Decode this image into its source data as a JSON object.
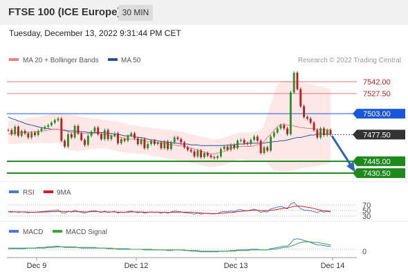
{
  "header": {
    "title": "FTSE 100 (ICE Europe)",
    "timeframe": "30 MIN"
  },
  "timestamp": "Tuesday, December 13, 2022 9:31:44 PM CET",
  "legend": {
    "ma20": "MA 20 + Bollinger Bands",
    "ma50": "MA 50",
    "credit": "Research © 2022 Trading Central",
    "rsi": "RSI",
    "rsi_ma": "9MA",
    "macd": "MACD",
    "macd_signal": "MACD Signal"
  },
  "colors": {
    "ma20": "#f08080",
    "bollinger_fill": "#fde3e3",
    "ma50": "#2c4f9e",
    "pivot_line": "#1a56db",
    "support": "#1e8a1e",
    "resistance": "#e07b7b",
    "up_candle": "#2e8b2e",
    "down_candle": "#b22222",
    "rsi": "#4a78d6",
    "rsi_ma": "#d81b1b",
    "macd": "#4a78d6",
    "macd_signal": "#3ca53c",
    "arrow": "#2f63b3"
  },
  "chart_data": [
    {
      "type": "candlestick",
      "title": "FTSE 100 (ICE Europe)",
      "timeframe": "30 MIN",
      "x_tick_labels": [
        "Dec 9",
        "Dec 12",
        "Dec 13",
        "Dec 14"
      ],
      "ylim": [
        7418,
        7562
      ],
      "last_price": 7477.5,
      "levels": [
        {
          "label": "7542.00",
          "value": 7542.0,
          "kind": "resistance"
        },
        {
          "label": "7527.50",
          "value": 7527.5,
          "kind": "resistance"
        },
        {
          "label": "7503.00",
          "value": 7503.0,
          "kind": "pivot"
        },
        {
          "label": "7477.50",
          "value": 7477.5,
          "kind": "last"
        },
        {
          "label": "7445.00",
          "value": 7445.0,
          "kind": "support"
        },
        {
          "label": "7430.50",
          "value": 7430.5,
          "kind": "support"
        }
      ],
      "close_series": [
        7483,
        7478,
        7487,
        7476,
        7482,
        7479,
        7474,
        7480,
        7477,
        7482,
        7485,
        7487,
        7489,
        7492,
        7495,
        7497,
        7470,
        7463,
        7478,
        7474,
        7488,
        7479,
        7471,
        7465,
        7476,
        7481,
        7486,
        7478,
        7472,
        7483,
        7472,
        7476,
        7479,
        7467,
        7472,
        7470,
        7476,
        7479,
        7473,
        7466,
        7472,
        7461,
        7466,
        7470,
        7466,
        7468,
        7461,
        7469,
        7460,
        7468,
        7474,
        7472,
        7468,
        7462,
        7459,
        7457,
        7451,
        7458,
        7450,
        7455,
        7452,
        7450,
        7449,
        7451,
        7460,
        7463,
        7459,
        7465,
        7461,
        7470,
        7471,
        7467,
        7466,
        7471,
        7475,
        7470,
        7455,
        7462,
        7458,
        7475,
        7480,
        7485,
        7489,
        7485,
        7478,
        7529,
        7553,
        7533,
        7512,
        7499,
        7497,
        7492,
        7483,
        7474,
        7485,
        7477,
        7483,
        7477.5
      ],
      "ma20_series": [
        7478,
        7479,
        7479,
        7480,
        7480,
        7480,
        7480,
        7481,
        7481,
        7481,
        7482,
        7482,
        7483,
        7484,
        7484,
        7484,
        7483,
        7482,
        7481,
        7480,
        7480,
        7479,
        7479,
        7479,
        7479,
        7479,
        7479,
        7479,
        7478,
        7478,
        7477,
        7476,
        7476,
        7475,
        7474,
        7473,
        7472,
        7472,
        7472,
        7471,
        7471,
        7470,
        7469,
        7469,
        7468,
        7468,
        7467,
        7467,
        7466,
        7465,
        7465,
        7464,
        7464,
        7463,
        7462,
        7461,
        7460,
        7459,
        7458,
        7456,
        7455,
        7454,
        7454,
        7455,
        7456,
        7457,
        7459,
        7461,
        7462,
        7463,
        7463,
        7463,
        7463,
        7463,
        7464,
        7465,
        7466,
        7469,
        7474,
        7478,
        7483,
        7487,
        7490,
        7490,
        7489,
        7489,
        7488,
        7487,
        7486,
        7486,
        7485,
        7485,
        7485,
        7484,
        7484,
        7483,
        7483,
        7483
      ],
      "ma50_series": [
        7499,
        7497,
        7496,
        7494,
        7493,
        7491,
        7490,
        7489,
        7488,
        7487,
        7486,
        7485,
        7485,
        7484,
        7484,
        7484,
        7483,
        7483,
        7482,
        7482,
        7482,
        7481,
        7481,
        7481,
        7480,
        7480,
        7480,
        7480,
        7480,
        7480,
        7479,
        7479,
        7478,
        7478,
        7477,
        7476,
        7476,
        7476,
        7475,
        7474,
        7474,
        7473,
        7472,
        7471,
        7471,
        7470,
        7469,
        7469,
        7468,
        7468,
        7467,
        7467,
        7466,
        7466,
        7466,
        7465,
        7465,
        7465,
        7464,
        7464,
        7464,
        7464,
        7464,
        7464,
        7464,
        7464,
        7465,
        7465,
        7465,
        7466,
        7466,
        7466,
        7467,
        7467,
        7467,
        7467,
        7467,
        7467,
        7468,
        7468,
        7469,
        7469,
        7470,
        7470,
        7471,
        7472,
        7473,
        7474,
        7474,
        7475,
        7476,
        7477,
        7477,
        7478,
        7478,
        7478,
        7478,
        7478
      ],
      "bollinger_upper": [
        7494,
        7495,
        7495,
        7496,
        7496,
        7497,
        7498,
        7498,
        7499,
        7499,
        7500,
        7501,
        7502,
        7503,
        7503,
        7504,
        7504,
        7503,
        7503,
        7502,
        7501,
        7500,
        7499,
        7499,
        7498,
        7498,
        7497,
        7497,
        7496,
        7495,
        7495,
        7494,
        7494,
        7493,
        7492,
        7491,
        7490,
        7489,
        7489,
        7488,
        7487,
        7487,
        7486,
        7486,
        7485,
        7485,
        7484,
        7484,
        7483,
        7483,
        7482,
        7482,
        7481,
        7480,
        7479,
        7478,
        7477,
        7476,
        7475,
        7474,
        7473,
        7472,
        7472,
        7472,
        7473,
        7474,
        7475,
        7477,
        7478,
        7479,
        7480,
        7480,
        7480,
        7480,
        7481,
        7482,
        7483,
        7489,
        7502,
        7515,
        7528,
        7537,
        7542,
        7543,
        7543,
        7543,
        7543,
        7543,
        7542,
        7541,
        7540,
        7539,
        7538,
        7537,
        7536,
        7535,
        7534,
        7533
      ],
      "bollinger_lower": [
        7466,
        7466,
        7466,
        7467,
        7467,
        7467,
        7467,
        7467,
        7467,
        7467,
        7467,
        7467,
        7467,
        7467,
        7468,
        7468,
        7464,
        7461,
        7459,
        7458,
        7458,
        7457,
        7458,
        7458,
        7459,
        7460,
        7460,
        7461,
        7461,
        7461,
        7460,
        7459,
        7458,
        7457,
        7456,
        7456,
        7455,
        7455,
        7455,
        7454,
        7454,
        7454,
        7453,
        7452,
        7451,
        7451,
        7450,
        7449,
        7448,
        7447,
        7447,
        7446,
        7446,
        7445,
        7444,
        7443,
        7442,
        7441,
        7440,
        7439,
        7438,
        7438,
        7438,
        7439,
        7440,
        7441,
        7442,
        7444,
        7446,
        7447,
        7447,
        7447,
        7446,
        7446,
        7446,
        7446,
        7446,
        7446,
        7443,
        7438,
        7434,
        7433,
        7432,
        7432,
        7432,
        7433,
        7434,
        7435,
        7436,
        7437,
        7437,
        7438,
        7438,
        7439,
        7440,
        7441,
        7442,
        7443
      ],
      "forecast": {
        "from": 7477.5,
        "to": 7439,
        "direction": "down"
      }
    },
    {
      "type": "line",
      "title": "RSI",
      "series_names": [
        "RSI",
        "9MA"
      ],
      "y_tick_labels": [
        "70",
        "50",
        "30"
      ],
      "ylim": [
        20,
        80
      ],
      "rsi_series": [
        45,
        44,
        46,
        43,
        45,
        44,
        42,
        44,
        43,
        45,
        46,
        47,
        48,
        50,
        51,
        52,
        42,
        40,
        47,
        45,
        51,
        47,
        43,
        41,
        46,
        48,
        50,
        46,
        43,
        48,
        43,
        45,
        47,
        41,
        44,
        43,
        46,
        48,
        45,
        42,
        45,
        40,
        43,
        45,
        43,
        44,
        40,
        45,
        40,
        45,
        48,
        47,
        45,
        42,
        41,
        40,
        37,
        41,
        37,
        40,
        39,
        38,
        38,
        39,
        45,
        47,
        45,
        49,
        46,
        52,
        53,
        50,
        49,
        52,
        55,
        51,
        43,
        47,
        45,
        56,
        59,
        62,
        65,
        61,
        56,
        74,
        79,
        67,
        57,
        52,
        51,
        49,
        46,
        42,
        48,
        44,
        47,
        45
      ],
      "ma_series": [
        46,
        46,
        45,
        45,
        45,
        45,
        44,
        44,
        44,
        44,
        44,
        45,
        45,
        46,
        46,
        47,
        47,
        46,
        46,
        46,
        46,
        46,
        46,
        45,
        45,
        46,
        46,
        46,
        45,
        45,
        45,
        45,
        45,
        44,
        44,
        44,
        44,
        45,
        45,
        45,
        45,
        44,
        44,
        44,
        44,
        44,
        43,
        43,
        43,
        43,
        44,
        44,
        44,
        44,
        44,
        44,
        43,
        42,
        41,
        40,
        40,
        39,
        39,
        39,
        40,
        41,
        42,
        43,
        44,
        46,
        47,
        48,
        49,
        50,
        51,
        51,
        50,
        50,
        50,
        51,
        52,
        54,
        56,
        58,
        59,
        62,
        65,
        66,
        66,
        64,
        62,
        60,
        57,
        54,
        51,
        49,
        48,
        47
      ]
    },
    {
      "type": "line",
      "title": "MACD",
      "series_names": [
        "MACD",
        "MACD Signal"
      ],
      "y_tick_labels": [
        "0"
      ],
      "ylim": [
        -10,
        30
      ],
      "macd_series": [
        2,
        2,
        2,
        2,
        2,
        2,
        2,
        2,
        2,
        3,
        3,
        3,
        4,
        4,
        5,
        5,
        4,
        3,
        3,
        3,
        3,
        3,
        2,
        2,
        2,
        2,
        2,
        2,
        2,
        2,
        1,
        1,
        1,
        0,
        0,
        0,
        0,
        0,
        0,
        0,
        0,
        -1,
        -1,
        -1,
        -1,
        -1,
        -1,
        -1,
        -2,
        -2,
        -1,
        -1,
        -1,
        -2,
        -2,
        -3,
        -3,
        -3,
        -4,
        -4,
        -4,
        -4,
        -4,
        -4,
        -3,
        -3,
        -3,
        -2,
        -2,
        -1,
        -1,
        -1,
        -1,
        0,
        0,
        0,
        -1,
        -1,
        -1,
        1,
        2,
        3,
        4,
        5,
        5,
        10,
        16,
        17,
        16,
        14,
        13,
        11,
        9,
        7,
        7,
        6,
        5,
        5
      ],
      "signal_series": [
        1,
        1,
        1,
        1,
        1,
        1,
        2,
        2,
        2,
        2,
        2,
        2,
        3,
        3,
        3,
        4,
        4,
        4,
        4,
        4,
        4,
        3,
        3,
        3,
        3,
        3,
        3,
        2,
        2,
        2,
        2,
        2,
        1,
        1,
        1,
        1,
        1,
        0,
        0,
        0,
        0,
        0,
        0,
        0,
        -1,
        -1,
        -1,
        -1,
        -1,
        -1,
        -1,
        -1,
        -1,
        -1,
        -2,
        -2,
        -2,
        -2,
        -3,
        -3,
        -3,
        -3,
        -3,
        -3,
        -3,
        -3,
        -3,
        -3,
        -3,
        -2,
        -2,
        -2,
        -2,
        -1,
        -1,
        -1,
        -1,
        -1,
        -1,
        0,
        0,
        1,
        2,
        3,
        3,
        5,
        7,
        9,
        11,
        12,
        12,
        12,
        11,
        11,
        10,
        9,
        8,
        7
      ]
    }
  ]
}
